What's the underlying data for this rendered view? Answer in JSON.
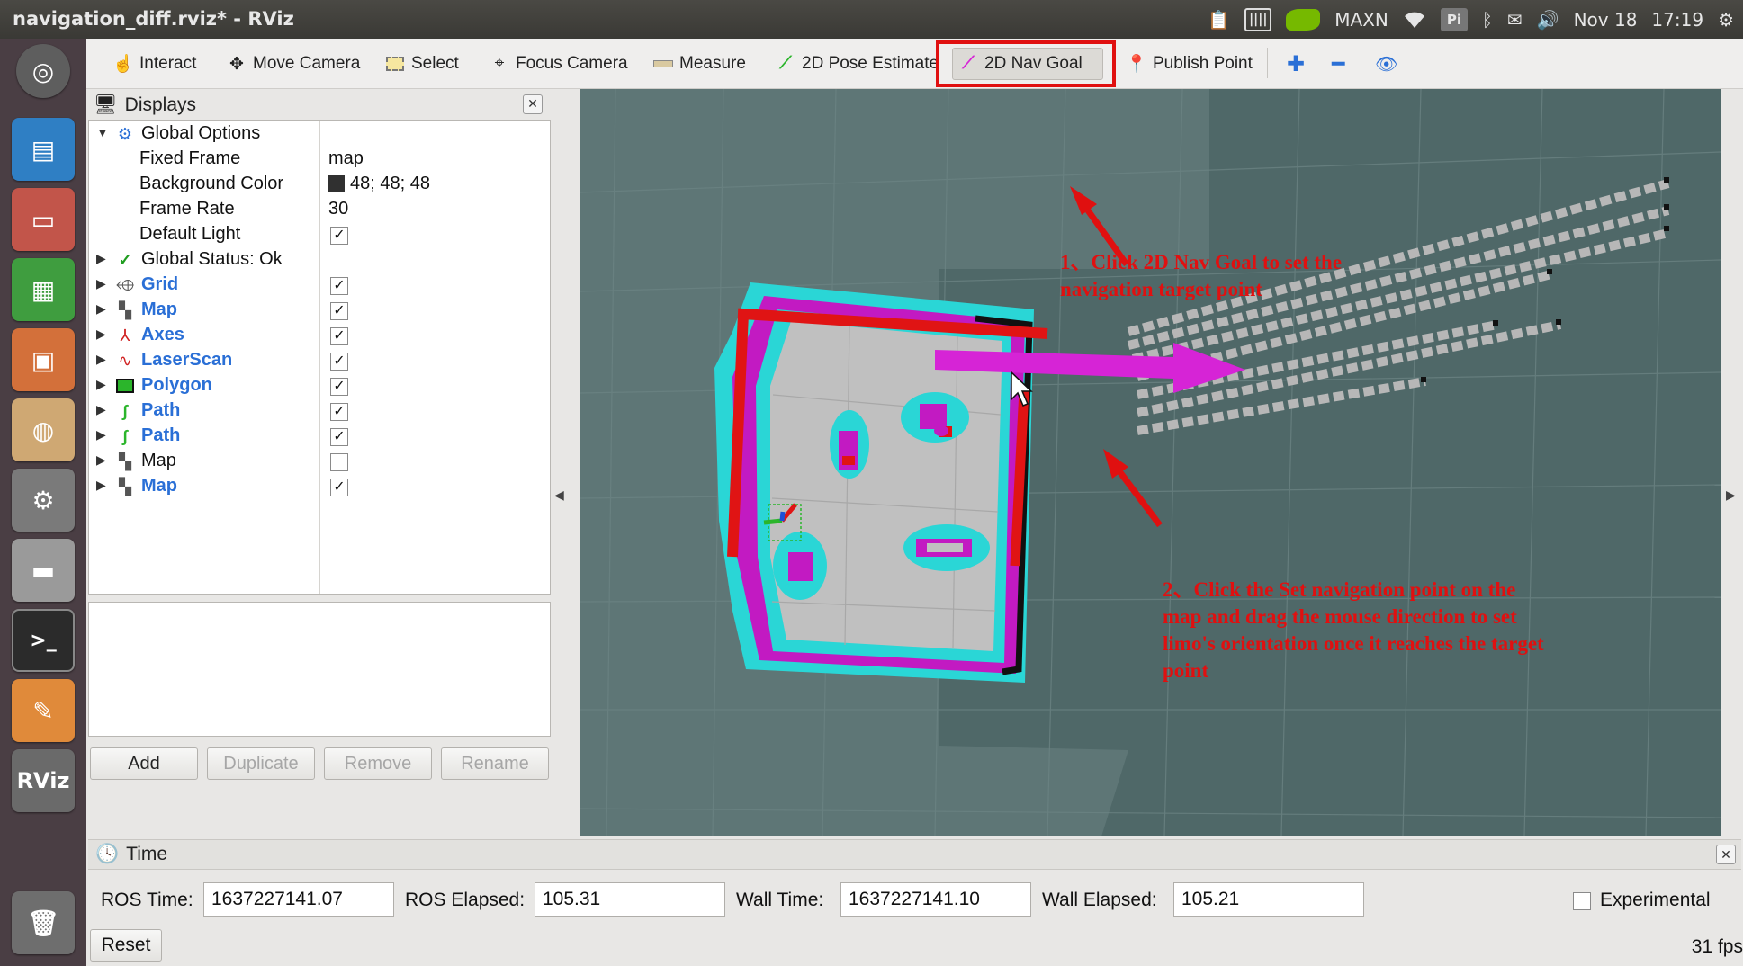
{
  "window": {
    "title": "navigation_diff.rviz* - RViz"
  },
  "tray": {
    "power_mode": "MAXN",
    "pi_label": "Pi",
    "date": "Nov 18",
    "time": "17:19"
  },
  "launcher": {
    "rviz_label": "RViz"
  },
  "toolbar": {
    "interact": "Interact",
    "move_camera": "Move Camera",
    "select": "Select",
    "focus_camera": "Focus Camera",
    "measure": "Measure",
    "pose_estimate": "2D Pose Estimate",
    "nav_goal": "2D Nav Goal",
    "publish_point": "Publish Point"
  },
  "displays": {
    "title": "Displays",
    "rows": [
      {
        "name": "Global Options",
        "value": ""
      },
      {
        "name": "Fixed Frame",
        "value": "map"
      },
      {
        "name": "Background Color",
        "value": "48; 48; 48"
      },
      {
        "name": "Frame Rate",
        "value": "30"
      },
      {
        "name": "Default Light",
        "checked": true
      },
      {
        "name": "Global Status: Ok"
      },
      {
        "name": "Grid",
        "checked": true
      },
      {
        "name": "Map",
        "checked": true
      },
      {
        "name": "Axes",
        "checked": true
      },
      {
        "name": "LaserScan",
        "checked": true
      },
      {
        "name": "Polygon",
        "checked": true
      },
      {
        "name": "Path",
        "checked": true
      },
      {
        "name": "Path",
        "checked": true
      },
      {
        "name": "Map",
        "checked": false
      },
      {
        "name": "Map",
        "checked": true
      }
    ],
    "buttons": {
      "add": "Add",
      "duplicate": "Duplicate",
      "remove": "Remove",
      "rename": "Rename"
    }
  },
  "annotations": {
    "step1": "1、Click 2D Nav Goal to set the navigation target point",
    "step2": "2、Click the Set navigation point on the map and drag the mouse direction to set limo's orientation once it reaches the target point"
  },
  "time_panel": {
    "title": "Time",
    "ros_time_label": "ROS Time:",
    "ros_time": "1637227141.07",
    "ros_elapsed_label": "ROS Elapsed:",
    "ros_elapsed": "105.31",
    "wall_time_label": "Wall Time:",
    "wall_time": "1637227141.10",
    "wall_elapsed_label": "Wall Elapsed:",
    "wall_elapsed": "105.21",
    "experimental": "Experimental",
    "reset": "Reset",
    "fps": "31 fps"
  },
  "colors": {
    "accent_highlight": "#e01010",
    "nav_arrow": "#d624d6",
    "costmap_cyan": "#2ad6d6",
    "obstacle_magenta": "#c21ac2",
    "path_blue": "#2a6fd6"
  }
}
